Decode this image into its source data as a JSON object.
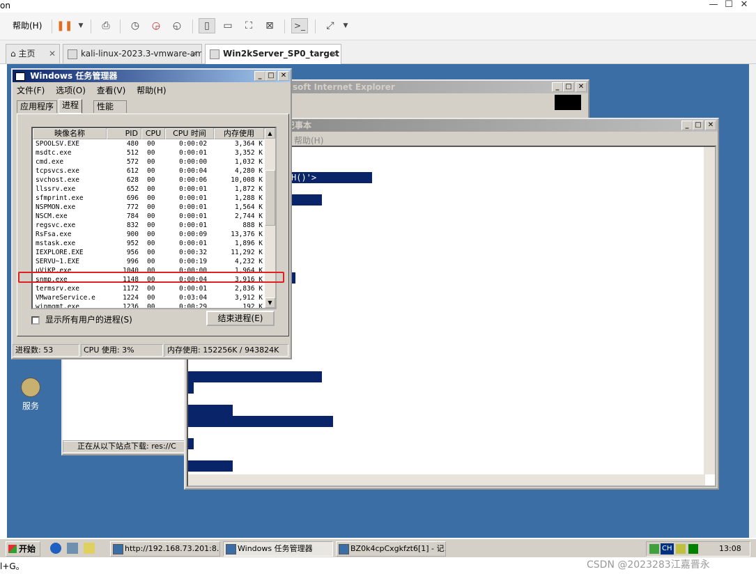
{
  "host": {
    "title_fragment": "on",
    "menu_help": "帮助(H)",
    "window_controls": [
      "—",
      "☐",
      "✕"
    ],
    "tabs": [
      {
        "label": "主页"
      },
      {
        "label": "kali-linux-2023.3-vmware-am..."
      },
      {
        "label": "Win2kServer_SP0_target"
      }
    ]
  },
  "ie_window": {
    "title": "soft Internet Explorer",
    "status": "正在从以下站点下载: res://C"
  },
  "notepad": {
    "title": "记事本",
    "menu_help": "帮助(H)",
    "visible_text": "H()'>"
  },
  "desktop_icon": {
    "label": "服务"
  },
  "taskmgr": {
    "title": "Windows 任务管理器",
    "menu": [
      "文件(F)",
      "选项(O)",
      "查看(V)",
      "帮助(H)"
    ],
    "tabs": [
      "应用程序",
      "进程",
      "性能"
    ],
    "columns": [
      "映像名称",
      "PID",
      "CPU",
      "CPU 时间",
      "内存使用"
    ],
    "processes": [
      {
        "name": "SPOOLSV.EXE",
        "pid": "480",
        "cpu": "00",
        "time": "0:00:02",
        "mem": "3,364 K"
      },
      {
        "name": "msdtc.exe",
        "pid": "512",
        "cpu": "00",
        "time": "0:00:01",
        "mem": "3,352 K"
      },
      {
        "name": "cmd.exe",
        "pid": "572",
        "cpu": "00",
        "time": "0:00:00",
        "mem": "1,032 K"
      },
      {
        "name": "tcpsvcs.exe",
        "pid": "612",
        "cpu": "00",
        "time": "0:00:04",
        "mem": "4,280 K"
      },
      {
        "name": "svchost.exe",
        "pid": "628",
        "cpu": "00",
        "time": "0:00:06",
        "mem": "10,008 K"
      },
      {
        "name": "llssrv.exe",
        "pid": "652",
        "cpu": "00",
        "time": "0:00:01",
        "mem": "1,872 K"
      },
      {
        "name": "sfmprint.exe",
        "pid": "696",
        "cpu": "00",
        "time": "0:00:01",
        "mem": "1,288 K"
      },
      {
        "name": "NSPMON.exe",
        "pid": "772",
        "cpu": "00",
        "time": "0:00:01",
        "mem": "1,564 K"
      },
      {
        "name": "NSCM.exe",
        "pid": "784",
        "cpu": "00",
        "time": "0:00:01",
        "mem": "2,744 K"
      },
      {
        "name": "regsvc.exe",
        "pid": "832",
        "cpu": "00",
        "time": "0:00:01",
        "mem": "888 K"
      },
      {
        "name": "RsFsa.exe",
        "pid": "900",
        "cpu": "00",
        "time": "0:00:09",
        "mem": "13,376 K"
      },
      {
        "name": "mstask.exe",
        "pid": "952",
        "cpu": "00",
        "time": "0:00:01",
        "mem": "1,896 K"
      },
      {
        "name": "IEXPLORE.EXE",
        "pid": "956",
        "cpu": "00",
        "time": "0:00:32",
        "mem": "11,292 K"
      },
      {
        "name": "SERVU~1.EXE",
        "pid": "996",
        "cpu": "00",
        "time": "0:00:19",
        "mem": "4,232 K"
      },
      {
        "name": "uViKP.exe",
        "pid": "1040",
        "cpu": "00",
        "time": "0:00:00",
        "mem": "1,964 K"
      },
      {
        "name": "snmp.exe",
        "pid": "1148",
        "cpu": "00",
        "time": "0:00:04",
        "mem": "3,916 K"
      },
      {
        "name": "termsrv.exe",
        "pid": "1172",
        "cpu": "00",
        "time": "0:00:01",
        "mem": "2,836 K"
      },
      {
        "name": "VMwareService.e",
        "pid": "1224",
        "cpu": "00",
        "time": "0:03:04",
        "mem": "3,912 K"
      },
      {
        "name": "winmgmt.exe",
        "pid": "1236",
        "cpu": "00",
        "time": "0:00:29",
        "mem": "192 K"
      }
    ],
    "highlighted_process": "uViKP.exe",
    "show_all_label": "显示所有用户的进程(S)",
    "end_process_label": "结束进程(E)",
    "status": {
      "process_count": "进程数: 53",
      "cpu_usage": "CPU 使用: 3%",
      "mem_usage": "内存使用: 152256K / 943824K"
    }
  },
  "taskbar": {
    "start": "开始",
    "buttons": [
      {
        "label": "http://192.168.73.201:8..."
      },
      {
        "label": "Windows 任务管理器"
      },
      {
        "label": "BZ0k4cpCxgkfzt6[1] - 记..."
      }
    ],
    "tray_lang": "CH",
    "clock": "13:08"
  },
  "footer": {
    "text": "l+G。",
    "watermark": "CSDN @2023283江嘉晋永"
  },
  "colors": {
    "desktop": "#3a6ea5",
    "titlebar_active": "#0a246a",
    "highlight_border": "#e02020",
    "selection_block": "#0a246a"
  }
}
